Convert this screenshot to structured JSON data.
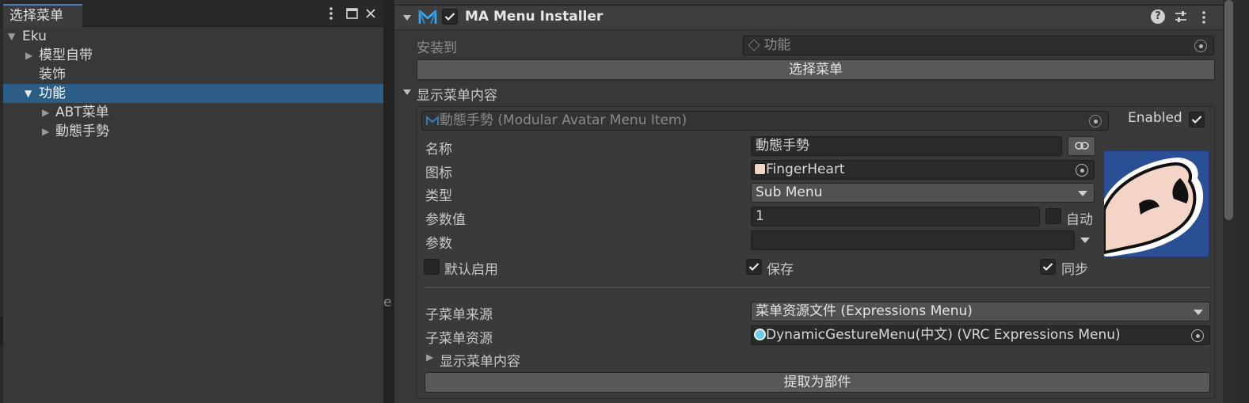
{
  "hierarchy": {
    "tab_title": "选择菜单",
    "items": [
      {
        "label": "Eku",
        "expanded": true
      },
      {
        "label": "模型自带",
        "expanded": false
      },
      {
        "label": "装饰"
      },
      {
        "label": "功能",
        "expanded": true,
        "selected": true
      },
      {
        "label": "ABT菜单",
        "expanded": false
      },
      {
        "label": "動態手勢",
        "expanded": false
      }
    ],
    "divider_fragment": "e"
  },
  "component": {
    "title": "MA Menu Installer",
    "enabled": true,
    "icons": [
      "modular-avatar-icon",
      "help-icon",
      "preset-icon",
      "kebab-menu-icon"
    ]
  },
  "installer": {
    "install_to_label": "安装到",
    "install_to_value": "功能",
    "select_menu_button": "选择菜单",
    "show_contents_label": "显示菜单内容"
  },
  "menu_item": {
    "object_field": "動態手勢 (Modular Avatar Menu Item)",
    "enabled_label": "Enabled",
    "enabled": true,
    "name_label": "名称",
    "name_value": "動態手勢",
    "icon_label": "图标",
    "icon_value": "FingerHeart",
    "type_label": "类型",
    "type_value": "Sub Menu",
    "param_value_label": "参数值",
    "param_value": "1",
    "auto_label": "自动",
    "auto_checked": false,
    "parameter_label": "参数",
    "parameter_value": "",
    "default_on_label": "默认启用",
    "default_on": false,
    "saved_label": "保存",
    "saved": true,
    "synced_label": "同步",
    "synced": true,
    "submenu_source_label": "子菜单来源",
    "submenu_source_value": "菜单资源文件 (Expressions Menu)",
    "submenu_asset_label": "子菜单资源",
    "submenu_asset_value": "DynamicGestureMenu(中文) (VRC Expressions Menu)",
    "show_contents_label": "显示菜单内容",
    "extract_button": "提取为部件"
  },
  "colors": {
    "accent_blue": "#2c5d87",
    "tab_highlight": "#4f7fc0",
    "preview_bg": "#2b4f94"
  }
}
